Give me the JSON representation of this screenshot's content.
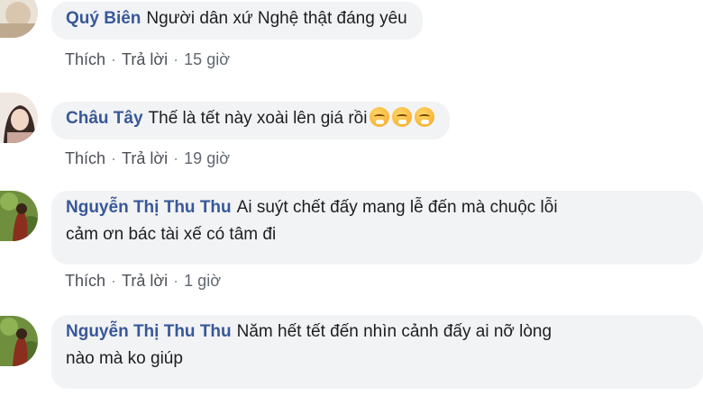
{
  "comments": [
    {
      "author": "Quý Biên",
      "text": "Người dân xứ Nghệ thật đáng yêu",
      "like_label": "Thích",
      "reply_label": "Trả lời",
      "time": "15 giờ"
    },
    {
      "author": "Châu Tây",
      "text": "Thế là tết này xoài lên giá rồi",
      "emojis": [
        "face-with-steam-emoji",
        "face-with-steam-emoji",
        "face-with-steam-emoji"
      ],
      "like_label": "Thích",
      "reply_label": "Trả lời",
      "time": "19 giờ"
    },
    {
      "author": "Nguyễn Thị Thu Thu",
      "text_line1": "Ai suýt chết đấy mang lễ đến mà chuộc lỗi",
      "text_line2": "cảm ơn bác tài xế có tâm đi",
      "like_label": "Thích",
      "reply_label": "Trả lời",
      "time": "1 giờ"
    },
    {
      "author": "Nguyễn Thị Thu Thu",
      "text_line1": "Năm hết tết đến nhìn cảnh đấy ai nỡ lòng",
      "text_line2": "nào mà ko giúp"
    }
  ],
  "separator": "·",
  "colors": {
    "author": "#385898",
    "bubble": "#f2f3f5",
    "meta": "#606770"
  }
}
